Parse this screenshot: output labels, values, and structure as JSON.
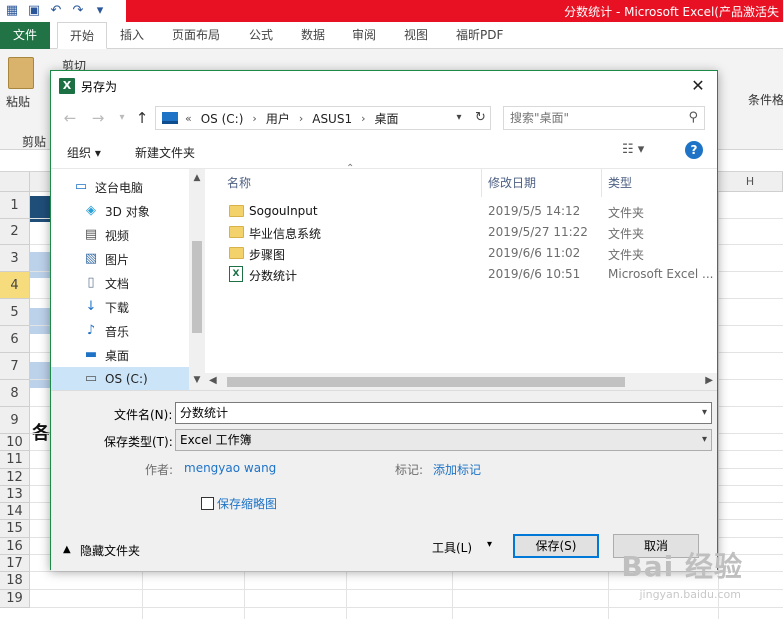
{
  "excel": {
    "window_title": "分数统计 - Microsoft Excel(产品激活失",
    "tabs": [
      "文件",
      "开始",
      "插入",
      "页面布局",
      "公式",
      "数据",
      "审阅",
      "视图",
      "福昕PDF"
    ],
    "ribbon": {
      "paste": "粘贴",
      "cut": "剪切",
      "clipboard": "剪贴",
      "cond_format": "条件格"
    },
    "row_numbers": [
      "1",
      "2",
      "3",
      "4",
      "5",
      "6",
      "7",
      "8",
      "9",
      "10",
      "11",
      "12",
      "13",
      "14",
      "15",
      "16",
      "17",
      "18",
      "19"
    ],
    "cell_text": "各",
    "col_partial": "H"
  },
  "dialog": {
    "title": "另存为",
    "breadcrumbs": [
      "OS (C:)",
      "用户",
      "ASUS1",
      "桌面"
    ],
    "breadcrumb_lead": "«",
    "search_placeholder": "搜索\"桌面\"",
    "toolbar": {
      "organize": "组织 ▾",
      "new_folder": "新建文件夹"
    },
    "tree": [
      {
        "label": "这台电脑",
        "icon": "computer-icon"
      },
      {
        "label": "3D 对象",
        "icon": "cube-icon"
      },
      {
        "label": "视频",
        "icon": "video-icon"
      },
      {
        "label": "图片",
        "icon": "picture-icon"
      },
      {
        "label": "文档",
        "icon": "document-icon"
      },
      {
        "label": "下载",
        "icon": "download-icon"
      },
      {
        "label": "音乐",
        "icon": "music-icon"
      },
      {
        "label": "桌面",
        "icon": "desktop-icon"
      },
      {
        "label": "OS (C:)",
        "icon": "drive-icon"
      }
    ],
    "columns": {
      "name": "名称",
      "modified": "修改日期",
      "type": "类型"
    },
    "files": [
      {
        "name": "SogouInput",
        "modified": "2019/5/5 14:12",
        "type": "文件夹",
        "kind": "folder"
      },
      {
        "name": "毕业信息系统",
        "modified": "2019/5/27 11:22",
        "type": "文件夹",
        "kind": "folder"
      },
      {
        "name": "步骤图",
        "modified": "2019/6/6 11:02",
        "type": "文件夹",
        "kind": "folder"
      },
      {
        "name": "分数统计",
        "modified": "2019/6/6 10:51",
        "type": "Microsoft Excel ...",
        "kind": "excel"
      }
    ],
    "form": {
      "filename_label": "文件名(N):",
      "filename_value": "分数统计",
      "filetype_label": "保存类型(T):",
      "filetype_value": "Excel 工作簿",
      "author_label": "作者:",
      "author_value": "mengyao wang",
      "tags_label": "标记:",
      "tags_value": "添加标记",
      "thumbnail_label": "保存缩略图",
      "hide_folders": "隐藏文件夹",
      "tools": "工具(L)",
      "save": "保存(S)",
      "cancel": "取消"
    }
  },
  "watermark": {
    "main": "Bai 经验",
    "sub": "jingyan.baidu.com"
  }
}
